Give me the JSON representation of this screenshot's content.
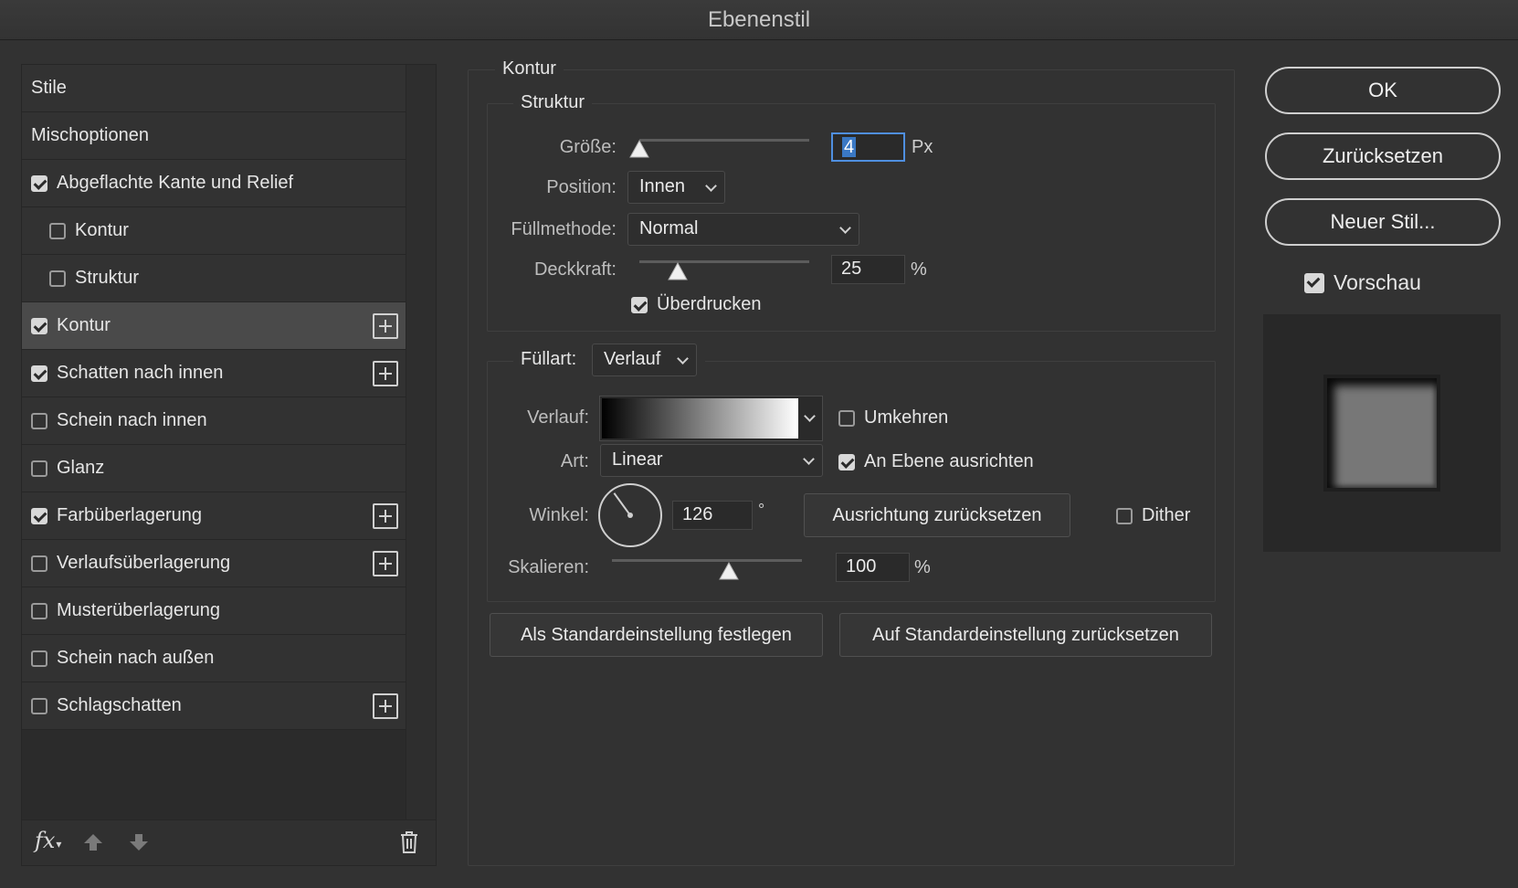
{
  "window": {
    "title": "Ebenenstil"
  },
  "styles": {
    "items": [
      {
        "label": "Stile",
        "checkbox": null,
        "indent": 0,
        "plus": false,
        "selected": false
      },
      {
        "label": "Mischoptionen",
        "checkbox": null,
        "indent": 0,
        "plus": false,
        "selected": false
      },
      {
        "label": "Abgeflachte Kante und Relief",
        "checkbox": true,
        "indent": 0,
        "plus": false,
        "selected": false
      },
      {
        "label": "Kontur",
        "checkbox": false,
        "indent": 1,
        "plus": false,
        "selected": false
      },
      {
        "label": "Struktur",
        "checkbox": false,
        "indent": 1,
        "plus": false,
        "selected": false
      },
      {
        "label": "Kontur",
        "checkbox": true,
        "indent": 0,
        "plus": true,
        "selected": true
      },
      {
        "label": "Schatten nach innen",
        "checkbox": true,
        "indent": 0,
        "plus": true,
        "selected": false
      },
      {
        "label": "Schein nach innen",
        "checkbox": false,
        "indent": 0,
        "plus": false,
        "selected": false
      },
      {
        "label": "Glanz",
        "checkbox": false,
        "indent": 0,
        "plus": false,
        "selected": false
      },
      {
        "label": "Farbüberlagerung",
        "checkbox": true,
        "indent": 0,
        "plus": true,
        "selected": false
      },
      {
        "label": "Verlaufsüberlagerung",
        "checkbox": false,
        "indent": 0,
        "plus": true,
        "selected": false
      },
      {
        "label": "Musterüberlagerung",
        "checkbox": false,
        "indent": 0,
        "plus": false,
        "selected": false
      },
      {
        "label": "Schein nach außen",
        "checkbox": false,
        "indent": 0,
        "plus": false,
        "selected": false
      },
      {
        "label": "Schlagschatten",
        "checkbox": false,
        "indent": 0,
        "plus": true,
        "selected": false
      }
    ],
    "footer": {
      "fx_label": "fx"
    }
  },
  "kontur": {
    "title": "Kontur",
    "struktur": {
      "title": "Struktur",
      "size_label": "Größe:",
      "size_value": "4",
      "size_unit": "Px",
      "size_slider_fraction": 0.0,
      "position_label": "Position:",
      "position_value": "Innen",
      "blend_label": "Füllmethode:",
      "blend_value": "Normal",
      "opacity_label": "Deckkraft:",
      "opacity_value": "25",
      "opacity_unit": "%",
      "overprint_label": "Überdrucken",
      "overprint_checked": true
    },
    "fill": {
      "type_label": "Füllart:",
      "type_value": "Verlauf",
      "gradient_label": "Verlauf:",
      "reverse_label": "Umkehren",
      "reverse_checked": false,
      "style_label": "Art:",
      "style_value": "Linear",
      "align_label": "An Ebene ausrichten",
      "align_checked": true,
      "angle_label": "Winkel:",
      "angle_value": "126",
      "angle_unit": "°",
      "reset_align_label": "Ausrichtung zurücksetzen",
      "dither_label": "Dither",
      "dither_checked": false,
      "scale_label": "Skalieren:",
      "scale_value": "100",
      "scale_unit": "%"
    },
    "make_default_label": "Als Standardeinstellung festlegen",
    "reset_default_label": "Auf Standardeinstellung zurücksetzen"
  },
  "buttons": {
    "ok": "OK",
    "reset": "Zurücksetzen",
    "new_style": "Neuer Stil...",
    "preview_label": "Vorschau",
    "preview_checked": true
  },
  "colors": {
    "background": "#323232",
    "selection_blue": "#3a78c4",
    "focus_border": "#4f8fe0"
  }
}
